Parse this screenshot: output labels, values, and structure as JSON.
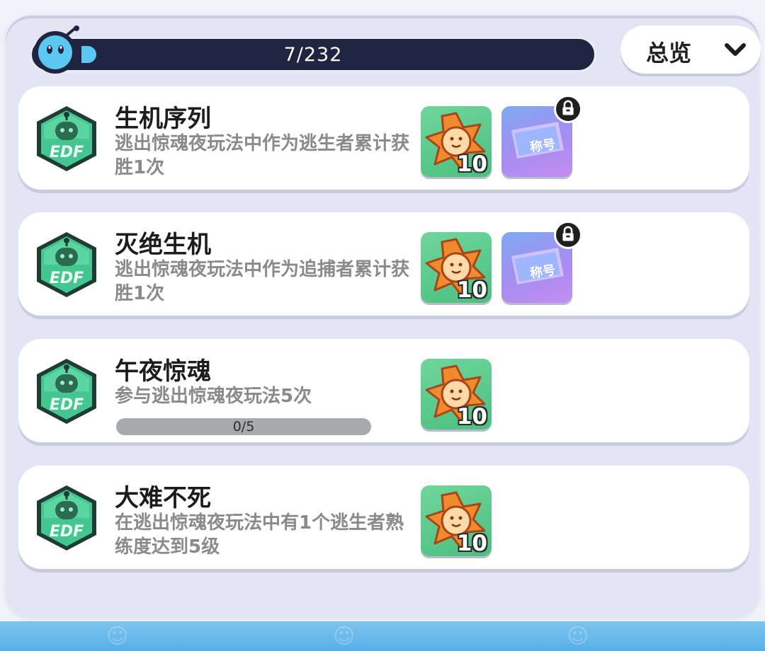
{
  "progress": {
    "current": 7,
    "total": 232,
    "text": "7/232",
    "fraction": 0.03
  },
  "filter": {
    "label": "总览",
    "icon": "chevron-down-icon"
  },
  "reward_labels": {
    "title_ticket": "称号"
  },
  "achievements": [
    {
      "title": "生机序列",
      "description": "逃出惊魂夜玩法中作为逃生者累计获胜1次",
      "badge_icon": "robot-badge-icon",
      "rewards": [
        {
          "type": "coin",
          "icon": "star-coin-icon",
          "quantity": "10"
        },
        {
          "type": "title",
          "icon": "title-ticket-icon",
          "locked": true
        }
      ]
    },
    {
      "title": "灭绝生机",
      "description": "逃出惊魂夜玩法中作为追捕者累计获胜1次",
      "badge_icon": "robot-badge-icon",
      "rewards": [
        {
          "type": "coin",
          "icon": "star-coin-icon",
          "quantity": "10"
        },
        {
          "type": "title",
          "icon": "title-ticket-icon",
          "locked": true
        }
      ]
    },
    {
      "title": "午夜惊魂",
      "description": "参与逃出惊魂夜玩法5次",
      "badge_icon": "robot-badge-icon",
      "progress": {
        "text": "0/5",
        "fraction": 0
      },
      "rewards": [
        {
          "type": "coin",
          "icon": "star-coin-icon",
          "quantity": "10"
        }
      ]
    },
    {
      "title": "大难不死",
      "description": "在逃出惊魂夜玩法中有1个逃生者熟练度达到5级",
      "badge_icon": "robot-badge-icon",
      "rewards": [
        {
          "type": "coin",
          "icon": "star-coin-icon",
          "quantity": "10"
        }
      ]
    }
  ],
  "colors": {
    "panel": "#e3e5f4",
    "card": "#ffffff",
    "progress_track": "#1f2540",
    "progress_fill": "#5cc7f0",
    "badge_green": "#3fbf8a",
    "coin_bg": "#5ccb8c",
    "title_bg": "#8fa0f2"
  }
}
